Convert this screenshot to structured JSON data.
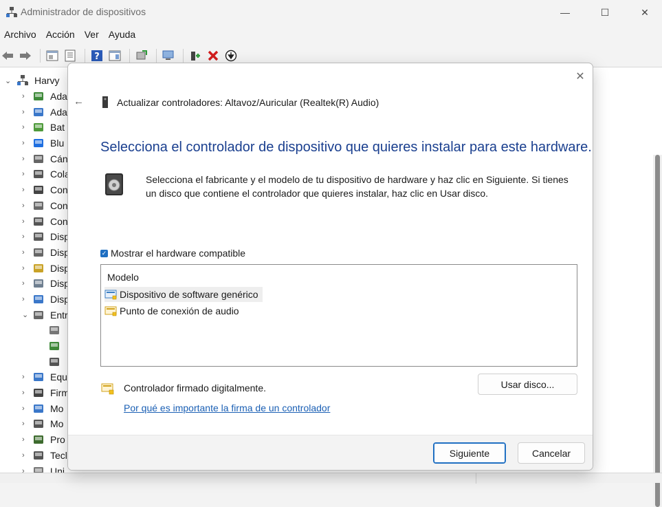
{
  "window": {
    "title": "Administrador de dispositivos",
    "controls": {
      "minimize": "—",
      "maximize": "☐",
      "close": "✕"
    }
  },
  "menu": [
    "Archivo",
    "Acción",
    "Ver",
    "Ayuda"
  ],
  "toolbar_icons": [
    "back-icon",
    "forward-icon",
    "properties-icon",
    "details-icon",
    "help-icon",
    "view-icon",
    "update-driver-icon",
    "scan-hardware-icon",
    "add-driver-icon",
    "uninstall-icon",
    "disable-icon"
  ],
  "tree": {
    "root": "Harvy",
    "items": [
      {
        "label": "Ada",
        "icon": "audio-adapter-icon"
      },
      {
        "label": "Ada",
        "icon": "display-adapter-icon"
      },
      {
        "label": "Bat",
        "icon": "battery-icon"
      },
      {
        "label": "Blu",
        "icon": "bluetooth-icon"
      },
      {
        "label": "Cán",
        "icon": "camera-icon"
      },
      {
        "label": "Cola",
        "icon": "print-queue-icon"
      },
      {
        "label": "Con",
        "icon": "controller-icon"
      },
      {
        "label": "Con",
        "icon": "storage-controller-icon"
      },
      {
        "label": "Con",
        "icon": "usb-controller-icon"
      },
      {
        "label": "Disp",
        "icon": "hid-icon"
      },
      {
        "label": "Disp",
        "icon": "sound-device-icon"
      },
      {
        "label": "Disp",
        "icon": "security-device-icon"
      },
      {
        "label": "Disp",
        "icon": "system-device-icon"
      },
      {
        "label": "Disp",
        "icon": "disk-icon"
      },
      {
        "label": "Entr",
        "icon": "audio-io-icon",
        "expanded": true
      }
    ],
    "children": [
      "speaker-child-icon",
      "network-card-child-icon",
      "microphone-child-icon"
    ],
    "items_after": [
      {
        "label": "Equ",
        "icon": "computer-icon"
      },
      {
        "label": "Firm",
        "icon": "firmware-icon"
      },
      {
        "label": "Mo",
        "icon": "monitor-icon"
      },
      {
        "label": "Mo",
        "icon": "mouse-icon"
      },
      {
        "label": "Pro",
        "icon": "processor-icon"
      },
      {
        "label": "Tecl",
        "icon": "keyboard-icon"
      },
      {
        "label": "Uni",
        "icon": "drive-icon"
      }
    ]
  },
  "dialog": {
    "title": "Actualizar controladores: Altavoz/Auricular (Realtek(R) Audio)",
    "heading": "Selecciona el controlador de dispositivo que quieres instalar para este hardware.",
    "description": "Selecciona el fabricante y el modelo de tu dispositivo de hardware y haz clic en Siguiente. Si tienes un disco que contiene el controlador que quieres instalar, haz clic en Usar disco.",
    "show_compatible": "Mostrar el hardware compatible",
    "list_header": "Modelo",
    "models": [
      "Dispositivo de software genérico",
      "Punto de conexión de audio"
    ],
    "signed_text": "Controlador firmado digitalmente.",
    "link": "Por qué es importante la firma de un controlador",
    "buttons": {
      "use_disk": "Usar disco...",
      "next": "Siguiente",
      "cancel": "Cancelar"
    },
    "accent": "#1a3f8f",
    "link_color": "#1a5fb4"
  }
}
